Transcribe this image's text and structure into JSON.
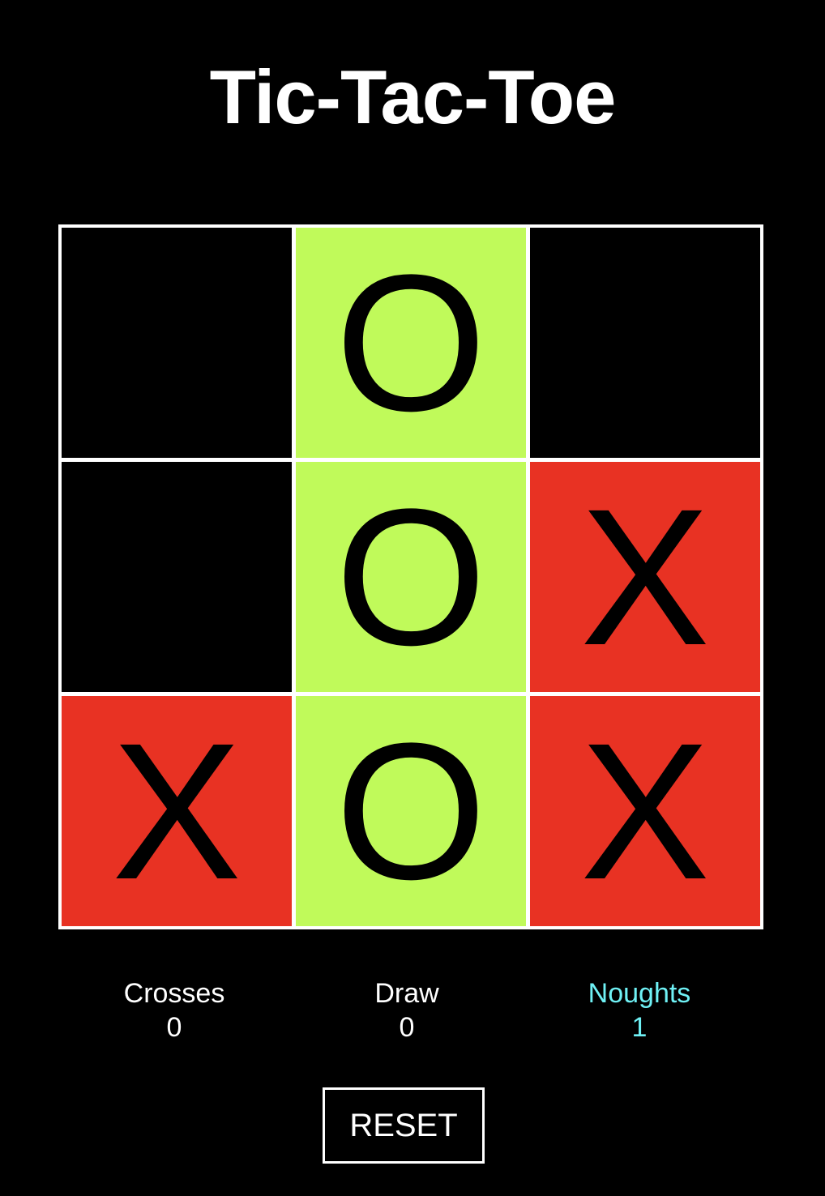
{
  "title": "Tic-Tac-Toe",
  "colors": {
    "background": "#000000",
    "cross_cell": "#e83223",
    "nought_cell": "#c0fa5a",
    "active_player": "#6ff1f5",
    "text": "#ffffff"
  },
  "board": {
    "cells": [
      "",
      "O",
      "",
      "",
      "O",
      "X",
      "X",
      "O",
      "X"
    ]
  },
  "scores": {
    "crosses": {
      "label": "Crosses",
      "value": "0"
    },
    "draw": {
      "label": "Draw",
      "value": "0"
    },
    "noughts": {
      "label": "Noughts",
      "value": "1"
    },
    "active": "noughts"
  },
  "reset_label": "RESET"
}
